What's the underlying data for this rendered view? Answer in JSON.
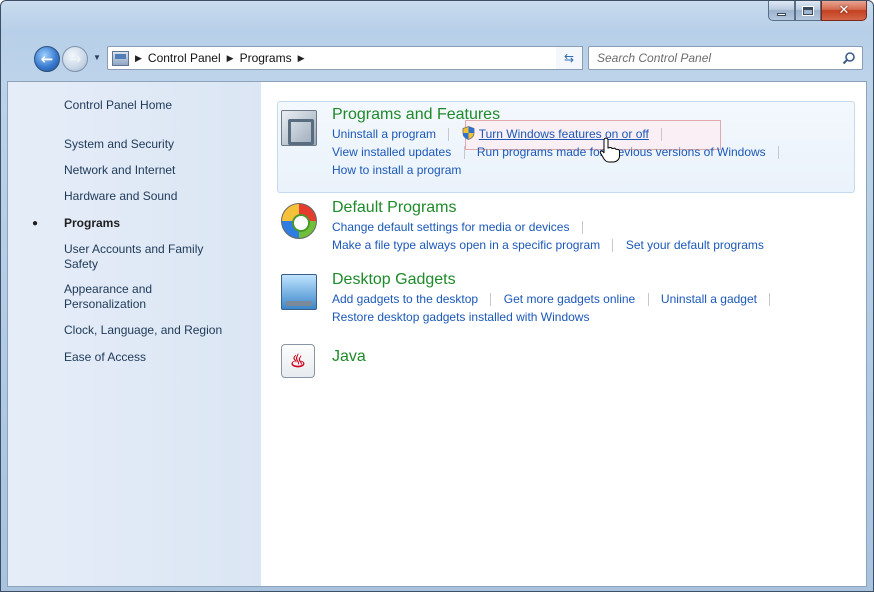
{
  "window": {
    "controls": {
      "minimize": "minimize",
      "maximize": "maximize",
      "close": "✕"
    }
  },
  "nav": {
    "breadcrumbs": [
      "Control Panel",
      "Programs"
    ],
    "search_placeholder": "Search Control Panel"
  },
  "sidebar": {
    "items": [
      {
        "label": "Control Panel Home",
        "active": false
      },
      {
        "label": "System and Security",
        "active": false
      },
      {
        "label": "Network and Internet",
        "active": false
      },
      {
        "label": "Hardware and Sound",
        "active": false
      },
      {
        "label": "Programs",
        "active": true
      },
      {
        "label": "User Accounts and Family Safety",
        "active": false
      },
      {
        "label": "Appearance and Personalization",
        "active": false
      },
      {
        "label": "Clock, Language, and Region",
        "active": false
      },
      {
        "label": "Ease of Access",
        "active": false
      }
    ]
  },
  "sections": {
    "programs_features": {
      "title": "Programs and Features",
      "links": {
        "uninstall": "Uninstall a program",
        "turn_features": "Turn Windows features on or off",
        "view_updates": "View installed updates",
        "run_previous": "Run programs made for previous versions of Windows",
        "how_install": "How to install a program"
      }
    },
    "default_programs": {
      "title": "Default Programs",
      "links": {
        "change_defaults": "Change default settings for media or devices",
        "file_type": "Make a file type always open in a specific program",
        "set_default": "Set your default programs"
      }
    },
    "desktop_gadgets": {
      "title": "Desktop Gadgets",
      "links": {
        "add": "Add gadgets to the desktop",
        "get_more": "Get more gadgets online",
        "uninstall": "Uninstall a gadget",
        "restore": "Restore desktop gadgets installed with Windows"
      }
    },
    "java": {
      "title": "Java"
    }
  },
  "colors": {
    "section_title": "#1e8a2a",
    "link": "#1b58b8",
    "sidebar_bg": "#dbe6f4",
    "hover_border": "#e0a9ad"
  },
  "icons": {
    "back": "back-arrow-icon",
    "forward": "forward-arrow-icon",
    "refresh": "refresh-icon",
    "search": "search-icon",
    "programs": "programs-and-features-icon",
    "default_programs": "default-programs-icon",
    "gadgets": "desktop-gadgets-icon",
    "java": "java-icon",
    "shield": "uac-shield-icon",
    "cursor": "hand-cursor-icon"
  }
}
